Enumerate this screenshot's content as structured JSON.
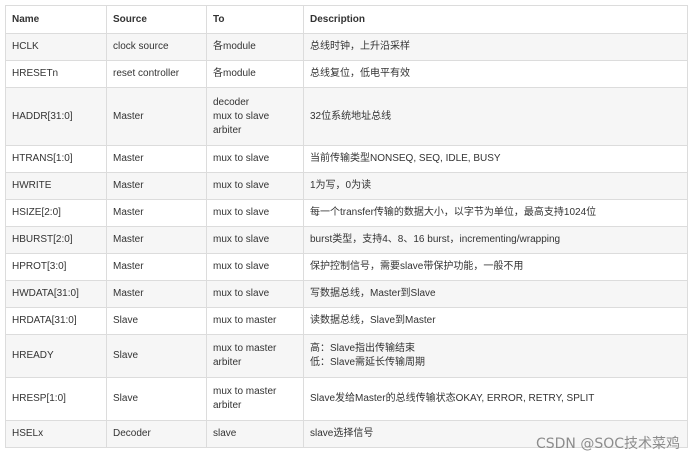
{
  "table": {
    "headers": {
      "name": "Name",
      "source": "Source",
      "to": "To",
      "description": "Description"
    },
    "rows": [
      {
        "name": "HCLK",
        "source": "clock source",
        "to": [
          "各module"
        ],
        "description": [
          "总线时钟，上升沿采样"
        ]
      },
      {
        "name": "HRESETn",
        "source": "reset controller",
        "to": [
          "各module"
        ],
        "description": [
          "总线复位，低电平有效"
        ]
      },
      {
        "name": "HADDR[31:0]",
        "source": "Master",
        "to": [
          "decoder",
          "mux to slave",
          "arbiter"
        ],
        "description": [
          "32位系统地址总线"
        ]
      },
      {
        "name": "HTRANS[1:0]",
        "source": "Master",
        "to": [
          "mux to slave"
        ],
        "description": [
          "当前传输类型NONSEQ, SEQ, IDLE, BUSY"
        ]
      },
      {
        "name": "HWRITE",
        "source": "Master",
        "to": [
          "mux to slave"
        ],
        "description": [
          "1为写，0为读"
        ]
      },
      {
        "name": "HSIZE[2:0]",
        "source": "Master",
        "to": [
          "mux to slave"
        ],
        "description": [
          "每一个transfer传输的数据大小，以字节为单位，最高支持1024位"
        ]
      },
      {
        "name": "HBURST[2:0]",
        "source": "Master",
        "to": [
          "mux to slave"
        ],
        "description": [
          "burst类型，支持4、8、16 burst，incrementing/wrapping"
        ]
      },
      {
        "name": "HPROT[3:0]",
        "source": "Master",
        "to": [
          "mux to slave"
        ],
        "description": [
          "保护控制信号，需要slave带保护功能，一般不用"
        ]
      },
      {
        "name": "HWDATA[31:0]",
        "source": "Master",
        "to": [
          "mux to slave"
        ],
        "description": [
          "写数据总线，Master到Slave"
        ]
      },
      {
        "name": "HRDATA[31:0]",
        "source": "Slave",
        "to": [
          "mux to master"
        ],
        "description": [
          "读数据总线，Slave到Master"
        ]
      },
      {
        "name": "HREADY",
        "source": "Slave",
        "to": [
          "mux to master",
          "arbiter"
        ],
        "description": [
          "高：Slave指出传输结束",
          "低：Slave需延长传输周期"
        ]
      },
      {
        "name": "HRESP[1:0]",
        "source": "Slave",
        "to": [
          "mux to master",
          "arbiter"
        ],
        "description": [
          "Slave发给Master的总线传输状态OKAY, ERROR, RETRY, SPLIT"
        ]
      },
      {
        "name": "HSELx",
        "source": "Decoder",
        "to": [
          "slave"
        ],
        "description": [
          "slave选择信号"
        ]
      }
    ]
  },
  "watermark": "CSDN @SOC技术菜鸡"
}
